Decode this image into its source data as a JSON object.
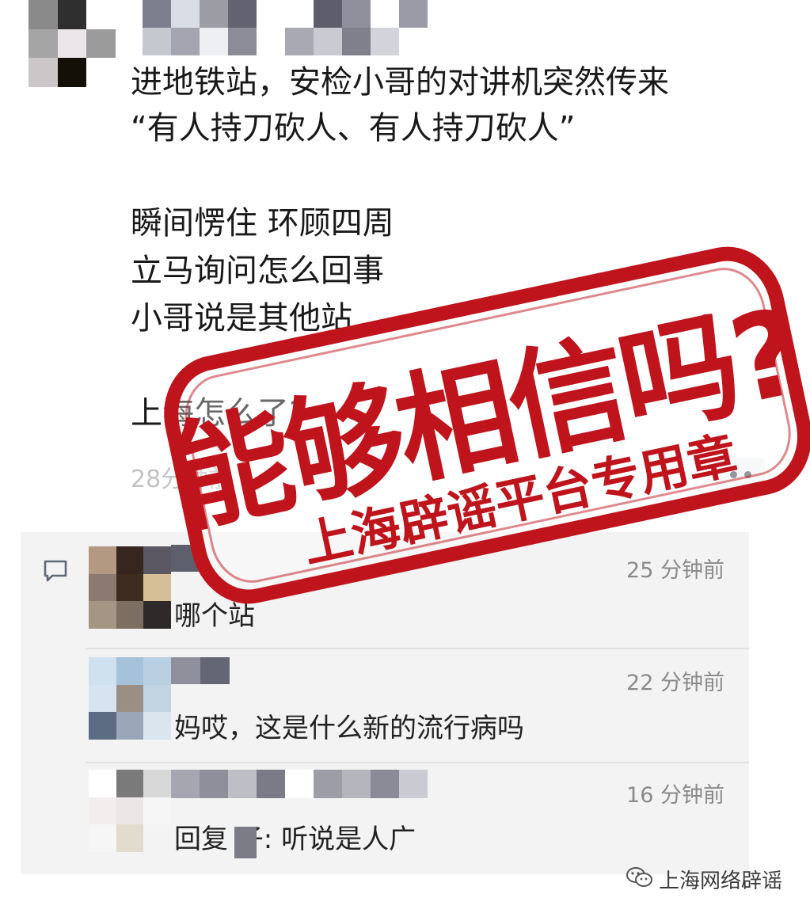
{
  "post": {
    "lines": [
      "进地铁站，安检小哥的对讲机突然传来",
      "“有人持刀砍人、有人持刀砍人”",
      "瞬间愣住 环顾四周",
      "立马询问怎么回事",
      "小哥说是其他站",
      "上海怎么了?"
    ],
    "time": "28分钟前"
  },
  "comments": [
    {
      "text": "哪个站",
      "time": "25 分钟前"
    },
    {
      "text": "妈哎，这是什么新的流行病吗",
      "time": "22 分钟前"
    },
    {
      "text": "回复 子: 听说是人广",
      "time": "16 分钟前"
    }
  ],
  "stamp": {
    "title": "能够相信吗?",
    "subtitle": "上海辟谣平台专用章",
    "color": "#c0141c"
  },
  "watermark": {
    "icon": "wechat-icon",
    "text": "上海网络辟谣"
  },
  "icons": {
    "comment": "comment-bubble-icon",
    "more": "more-dots-icon"
  }
}
